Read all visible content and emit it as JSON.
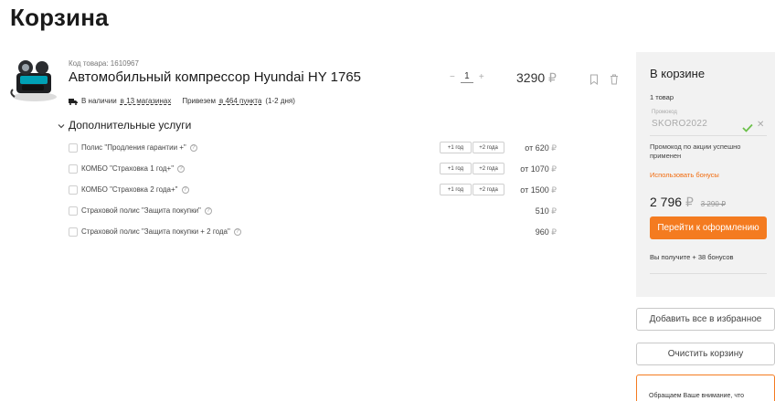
{
  "page": {
    "title": "Корзина"
  },
  "product": {
    "sku": "Код товара: 1610967",
    "title": "Автомобильный компрессор Hyundai HY 1765",
    "availability_prefix": "В наличии",
    "availability_link": "в 13 магазинах",
    "delivery_prefix": "Привезем",
    "delivery_link": "в 464 пункта",
    "delivery_suffix": "(1-2 дня)",
    "quantity": "1",
    "qty_minus": "−",
    "qty_plus": "+",
    "price": "3290",
    "currency": "₽"
  },
  "services": {
    "toggle_label": "Дополнительные услуги",
    "items": [
      {
        "label": "Полис \"Продления гарантии +\"",
        "options": [
          "+1 год",
          "+2 года"
        ],
        "price": "от 620"
      },
      {
        "label": "КОМБО \"Страховка 1 год+\"",
        "options": [
          "+1 год",
          "+2 года"
        ],
        "price": "от 1070"
      },
      {
        "label": "КОМБО \"Страховка 2 года+\"",
        "options": [
          "+1 год",
          "+2 года"
        ],
        "price": "от 1500"
      },
      {
        "label": "Страховой полис \"Защита покупки\"",
        "options": [],
        "price": "510"
      },
      {
        "label": "Страховой полис \"Защита покупки + 2 года\"",
        "options": [],
        "price": "960"
      }
    ],
    "help_glyph": "?"
  },
  "sidebar": {
    "title": "В корзине",
    "count": "1 товар",
    "promo_label": "Промокод",
    "promo_value": "SKORO2022",
    "promo_note": "Промокод по акции успешно применен",
    "use_bonus": "Использовать бонусы",
    "total": "2 796",
    "old_total": "3 290 ₽",
    "checkout": "Перейти к оформлению",
    "bonus_info": "Вы получите + 38 бонусов"
  },
  "actions": {
    "add_favorites": "Добавить все в избранное",
    "clear_cart": "Очистить корзину"
  },
  "notice": {
    "text": "Обращаем Ваше внимание, что"
  },
  "colors": {
    "accent": "#f47b20",
    "check": "#6cc04a",
    "sidebar_bg": "#f2f2f2"
  },
  "icons": {
    "truck": "truck-icon",
    "bookmark": "bookmark-icon",
    "trash": "trash-icon",
    "chevron": "chevron-down-icon",
    "check": "check-icon",
    "close": "close-icon"
  }
}
